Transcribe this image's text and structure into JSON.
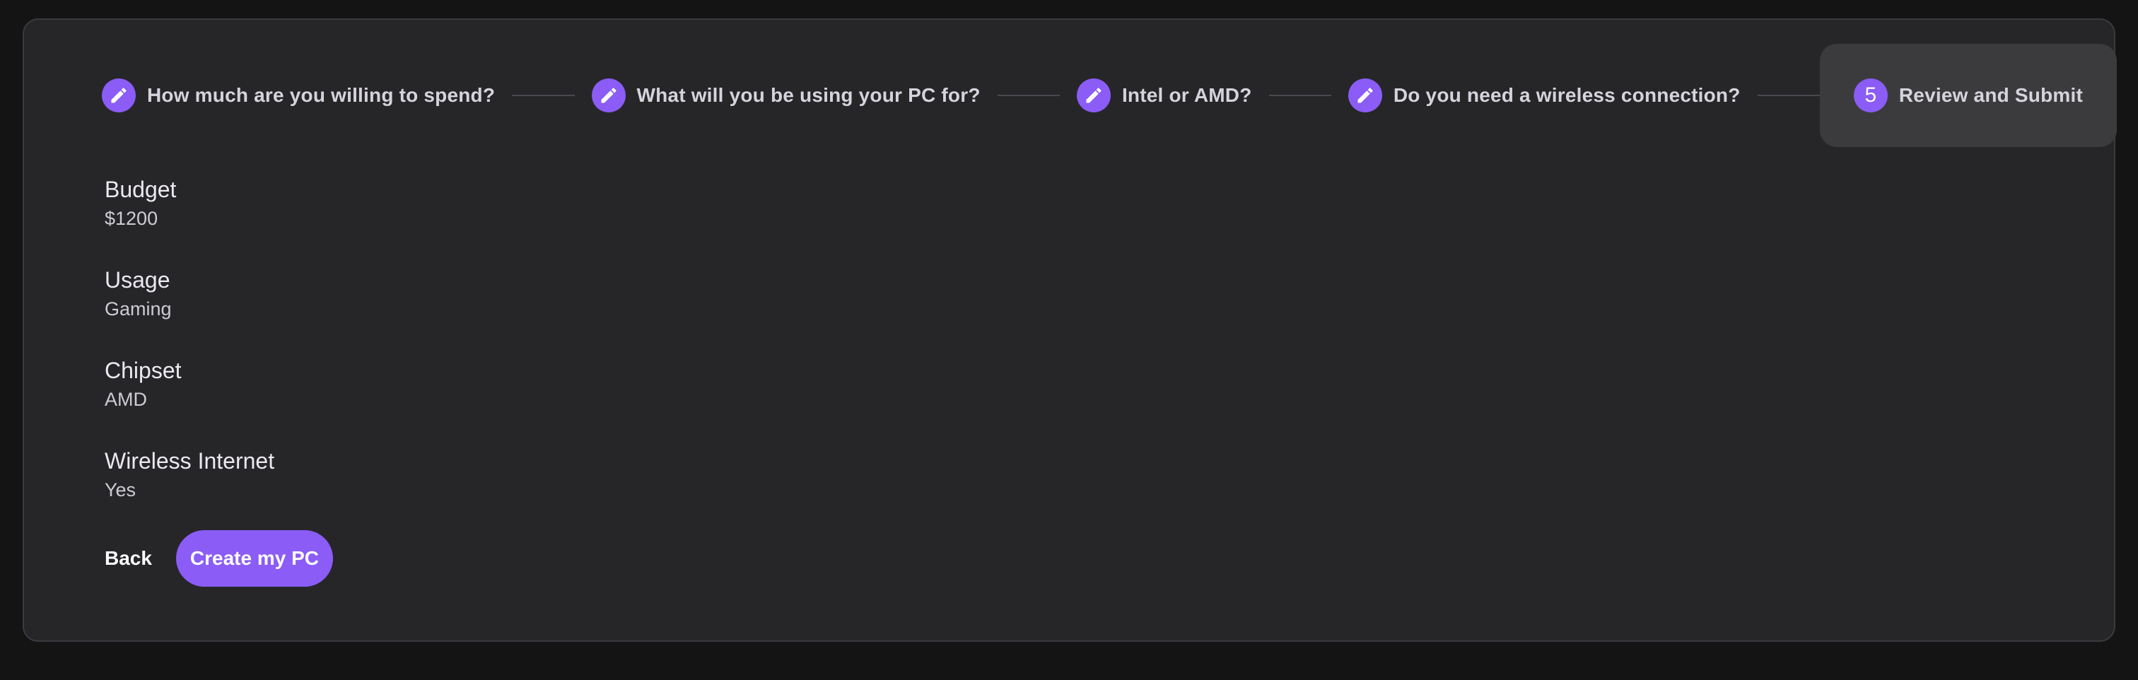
{
  "stepper": {
    "steps": [
      {
        "label": "How much are you willing to spend?",
        "icon": "pencil-icon"
      },
      {
        "label": "What will you be using your PC for?",
        "icon": "pencil-icon"
      },
      {
        "label": "Intel or AMD?",
        "icon": "pencil-icon"
      },
      {
        "label": "Do you need a wireless connection?",
        "icon": "pencil-icon"
      },
      {
        "label": "Review and Submit",
        "number": "5"
      }
    ],
    "active_step": 5
  },
  "summary": {
    "budget": {
      "title": "Budget",
      "value": "$1200"
    },
    "usage": {
      "title": "Usage",
      "value": "Gaming"
    },
    "chipset": {
      "title": "Chipset",
      "value": "AMD"
    },
    "wireless": {
      "title": "Wireless Internet",
      "value": "Yes"
    }
  },
  "actions": {
    "back_label": "Back",
    "create_label": "Create my PC"
  },
  "colors": {
    "accent": "#8b5cf6",
    "card_background": "#262629",
    "page_background": "#141414",
    "active_step_background": "#3b3b3e"
  }
}
